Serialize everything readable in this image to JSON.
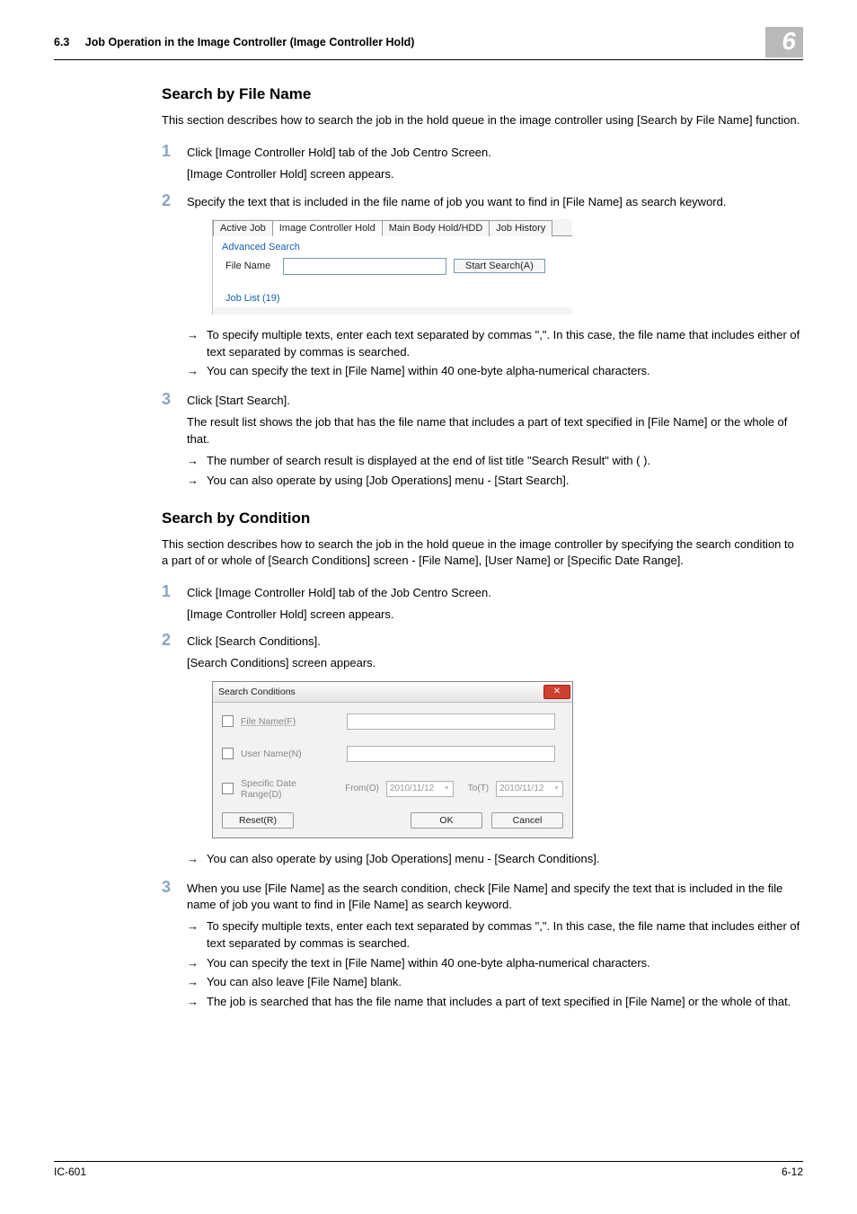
{
  "header": {
    "section_number": "6.3",
    "section_title": "Job Operation in the Image Controller (Image Controller Hold)",
    "chapter_badge": "6"
  },
  "s1": {
    "heading": "Search by File Name",
    "intro": "This section describes how to search the job in the hold queue in the image controller using [Search by File Name] function.",
    "step1": {
      "line": "Click [Image Controller Hold] tab of the Job Centro Screen.",
      "sub": "[Image Controller Hold] screen appears."
    },
    "step2": {
      "line": "Specify the text that is included in the file name of job you want to find in [File Name] as search keyword."
    },
    "shot1": {
      "tabs": {
        "t1": "Active Job",
        "t2": "Image Controller Hold",
        "t3": "Main Body Hold/HDD",
        "t4": "Job History"
      },
      "group": "Advanced Search",
      "label": "File Name",
      "button": "Start Search(A)",
      "joblist": "Job List (19)"
    },
    "bullets_a": {
      "b1": "To specify multiple texts, enter each text separated by commas \",\". In this case, the file name that includes either of text separated by commas is searched.",
      "b2": "You can specify the text in [File Name] within 40 one-byte alpha-numerical characters."
    },
    "step3": {
      "line": "Click [Start Search].",
      "sub": "The result list shows the job that has the file name that includes a part of text specified in [File Name] or the whole of that."
    },
    "bullets_b": {
      "b1": "The number of search result is displayed at the end of list title \"Search Result\" with ( ).",
      "b2": "You can also operate by using [Job Operations] menu - [Start Search]."
    }
  },
  "s2": {
    "heading": "Search by Condition",
    "intro": "This section describes how to search the job in the hold queue in the image controller by specifying the search condition to a part of or whole of [Search Conditions] screen - [File Name], [User Name] or [Specific Date Range].",
    "step1": {
      "line": "Click [Image Controller Hold] tab of the Job Centro Screen.",
      "sub": "[Image Controller Hold] screen appears."
    },
    "step2": {
      "line": "Click [Search Conditions].",
      "sub": "[Search Conditions] screen appears."
    },
    "shot2": {
      "title": "Search Conditions",
      "fn_label": "File Name(F)",
      "un_label": "User Name(N)",
      "dr_label": "Specific Date Range(D)",
      "from": "From(O)",
      "to": "To(T)",
      "date1": "2010/11/12",
      "date2": "2010/11/12",
      "reset": "Reset(R)",
      "ok": "OK",
      "cancel": "Cancel"
    },
    "bullets_a": {
      "b1": "You can also operate by using [Job Operations] menu - [Search Conditions]."
    },
    "step3": {
      "line": "When you use [File Name] as the search condition, check [File Name] and specify the text that is included in the file name of job you want to find in [File Name] as search keyword."
    },
    "bullets_b": {
      "b1": "To specify multiple texts, enter each text separated by commas \",\". In this case, the file name that includes either of text separated by commas is searched.",
      "b2": "You can specify the text in [File Name] within 40 one-byte alpha-numerical characters.",
      "b3": "You can also leave [File Name] blank.",
      "b4": "The job is searched that has the file name that includes a part of text specified in [File Name] or the whole of that."
    }
  },
  "footer": {
    "left": "IC-601",
    "right": "6-12"
  }
}
